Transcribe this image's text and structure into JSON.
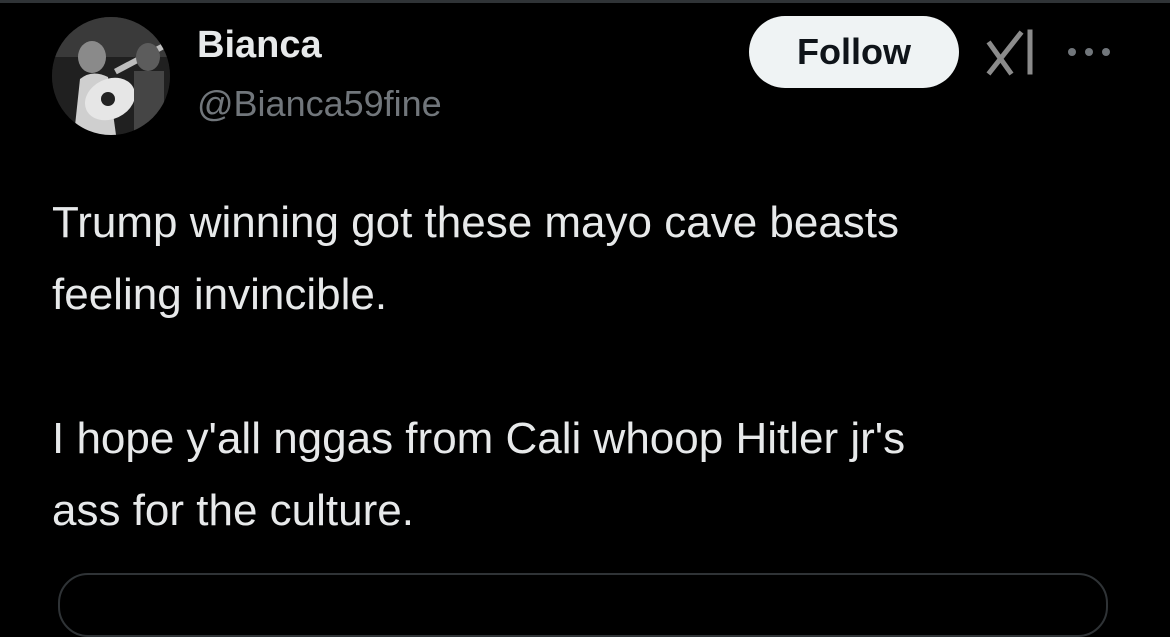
{
  "author": {
    "display_name": "Bianca",
    "handle": "@Bianca59fine"
  },
  "actions": {
    "follow_label": "Follow",
    "grok_icon": "grok-icon",
    "more_icon": "more-horizontal-icon"
  },
  "tweet": {
    "paragraph_1_line_1": "Trump winning got these mayo cave beasts",
    "paragraph_1_line_2": "feeling invincible.",
    "paragraph_2_line_1": "I hope y'all nggas from Cali whoop Hitler jr's",
    "paragraph_2_line_2": "ass for the culture."
  },
  "colors": {
    "background": "#000000",
    "primary_text": "#e7e9ea",
    "secondary_text": "#71767b",
    "follow_bg": "#eff3f4",
    "follow_text": "#0f1419",
    "border": "#2f3336"
  }
}
